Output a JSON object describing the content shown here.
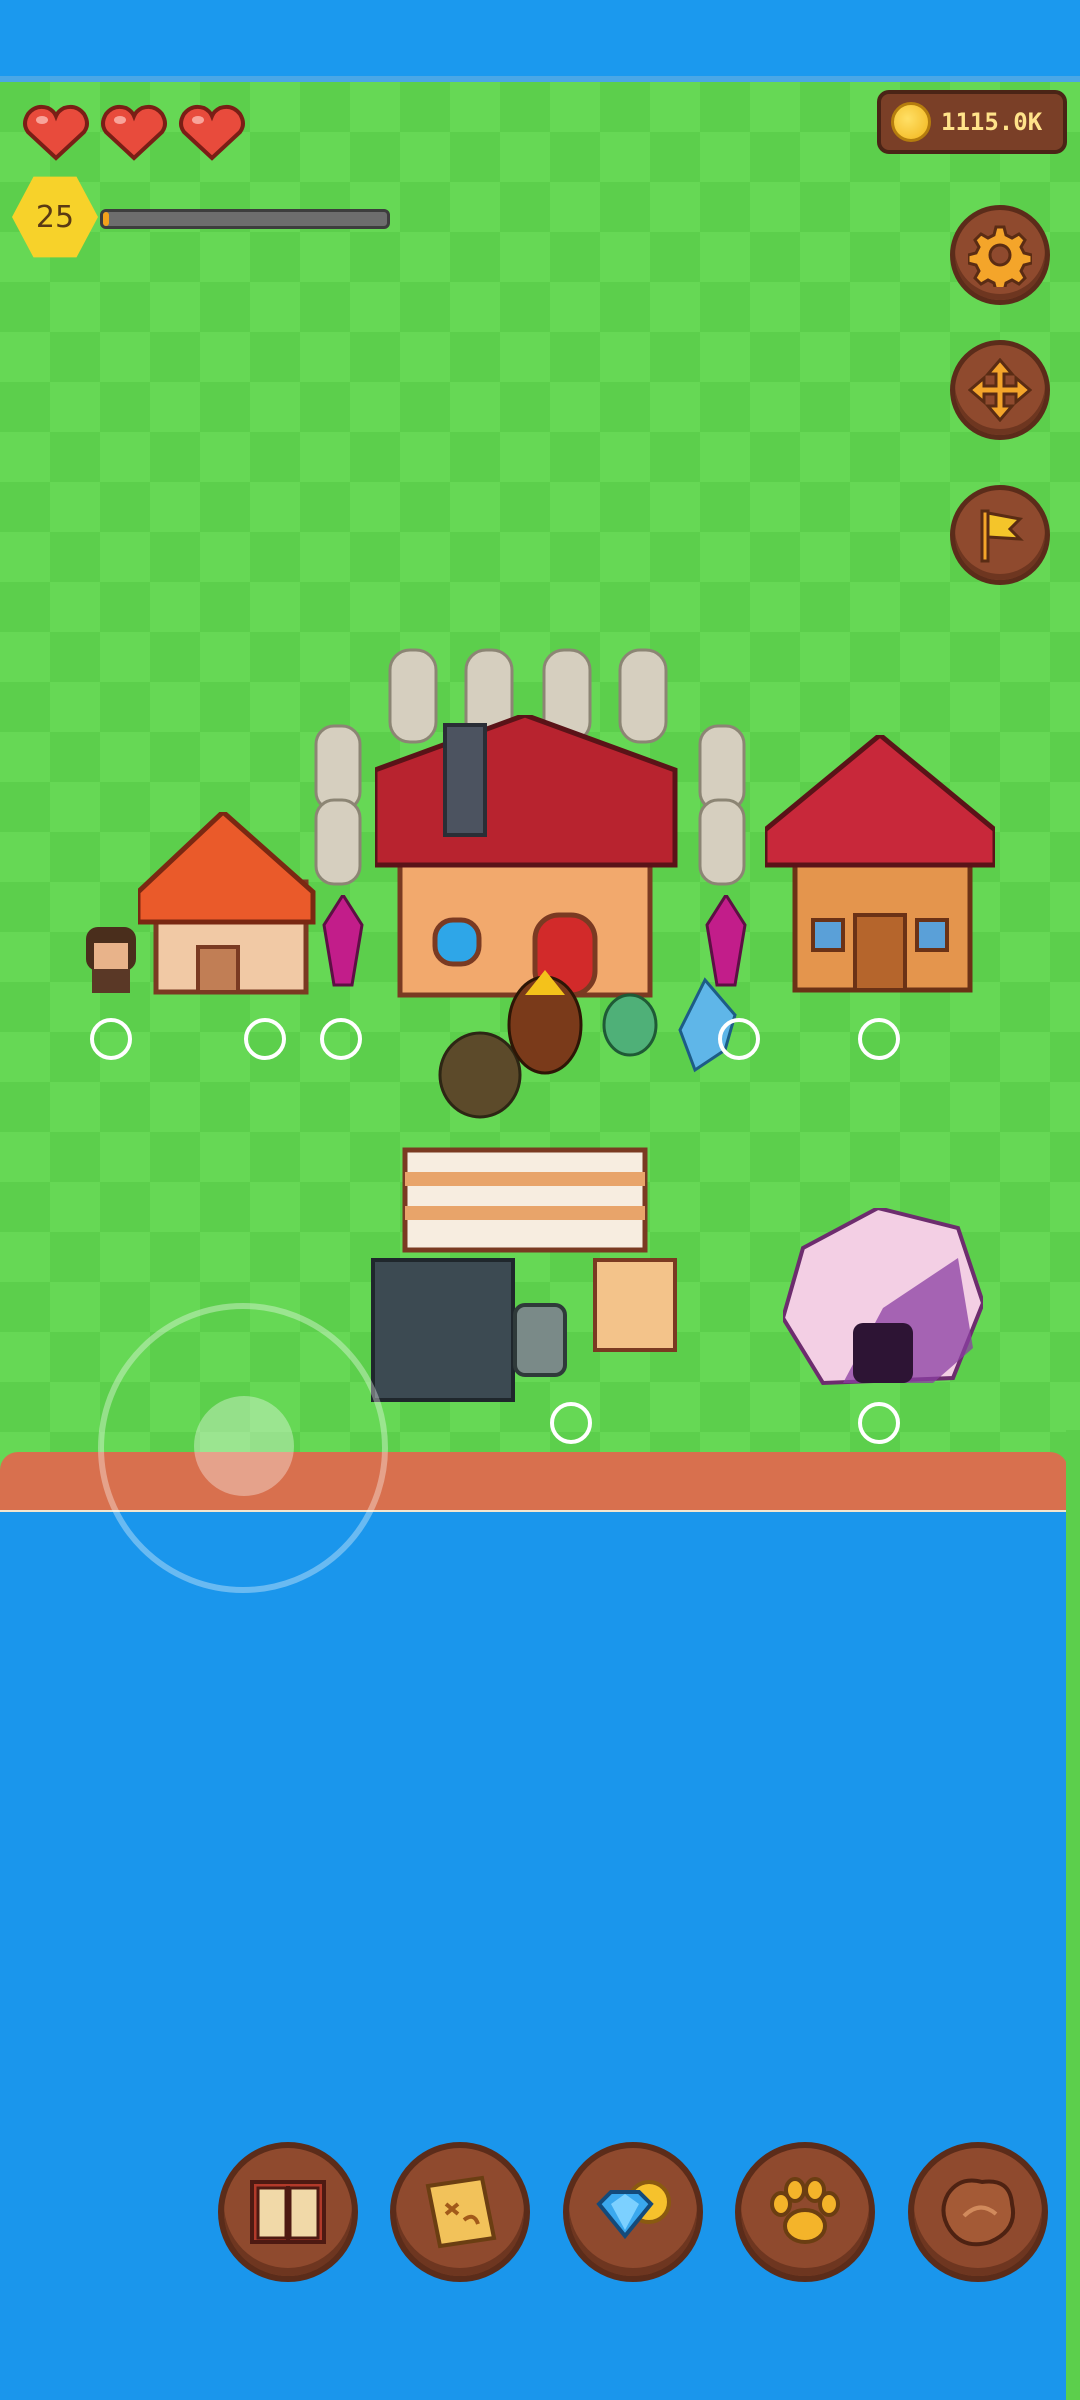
{
  "hud": {
    "hearts": {
      "count": 3,
      "filled": 3,
      "icon": "heart-icon",
      "color": "#e84b3c"
    },
    "level": "25",
    "xp_progress": 0.02,
    "coins": "1115.0K"
  },
  "side_buttons": [
    {
      "name": "settings-button",
      "icon": "gear-icon"
    },
    {
      "name": "move-button",
      "icon": "move-arrows-icon"
    },
    {
      "name": "flag-button",
      "icon": "flag-icon"
    }
  ],
  "bottom_buttons": [
    {
      "name": "book-button",
      "icon": "book-icon"
    },
    {
      "name": "map-button",
      "icon": "map-scroll-icon"
    },
    {
      "name": "shop-button",
      "icon": "gem-coin-icon"
    },
    {
      "name": "pets-button",
      "icon": "paw-icon"
    },
    {
      "name": "leather-button",
      "icon": "leather-icon"
    }
  ],
  "colors": {
    "grass": "#5ccf4c",
    "water": "#1a96ec",
    "button_brown": "#8f4a2e",
    "gold": "#f7d22a"
  }
}
